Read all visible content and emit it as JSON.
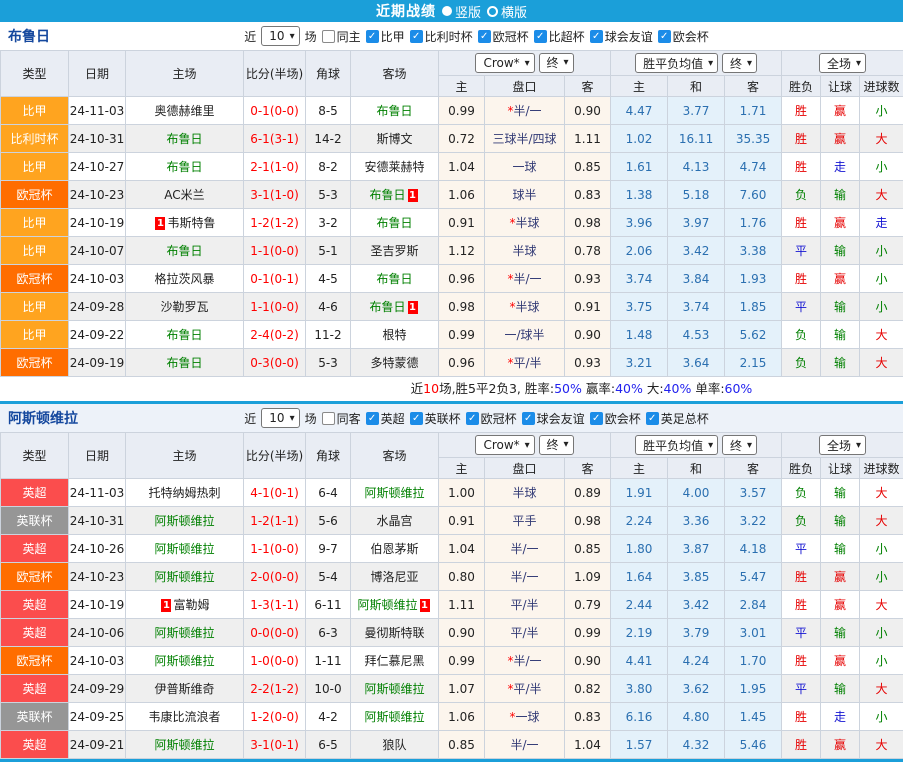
{
  "topbar": {
    "title": "近期战绩",
    "options": [
      {
        "label": "竖版",
        "selected": true
      },
      {
        "label": "横版",
        "selected": false
      }
    ]
  },
  "table_header": {
    "type": "类型",
    "date": "日期",
    "home": "主场",
    "score": "比分(半场)",
    "corner": "角球",
    "away": "客场",
    "dd_company": "Crow*",
    "dd_final": "终",
    "dd_avg": "胜平负均值",
    "dd_final2": "终",
    "dd_scope": "全场",
    "sub": {
      "home": "主",
      "handicap": "盘口",
      "away": "客",
      "avg_home": "主",
      "avg_draw": "和",
      "avg_away": "客",
      "result": "胜负",
      "let": "让球",
      "goals": "进球数"
    }
  },
  "colors": {
    "topbar_bg": "#1b9fd9",
    "checkbox_on": "#1b8ce8",
    "league": {
      "比甲": "#ffa41f",
      "比利时杯": "#ffa41f",
      "欧冠杯": "#ff6d00",
      "英超": "#fb4d4d",
      "英联杯": "#969696"
    },
    "result": {
      "胜": "#e60000",
      "负": "#008000",
      "平": "#1414d2",
      "赢": "#e60000",
      "输": "#008000",
      "走": "#1414d2",
      "大": "#e60000",
      "小": "#008000"
    },
    "team_highlight": "#008000",
    "score": "#ff0000",
    "handicap_text": "#333b76",
    "avg_text": "#2a6fb0"
  },
  "sections": [
    {
      "team": "布鲁日",
      "filters": {
        "near": "近",
        "count": "10",
        "games": "场",
        "same": "同主",
        "same_checked": false,
        "leagues": [
          "比甲",
          "比利时杯",
          "欧冠杯",
          "比超杯",
          "球会友谊",
          "欧会杯"
        ]
      },
      "rows": [
        {
          "type": "比甲",
          "date": "24-11-03",
          "home": "奥德赫维里",
          "home_card": "",
          "score": "0-1(0-0)",
          "corner": "8-5",
          "away": "布鲁日",
          "away_card": "",
          "odds_home": "0.99",
          "handicap": "*半/一",
          "odds_away": "0.90",
          "avg_home": "4.47",
          "avg_draw": "3.77",
          "avg_away": "1.71",
          "result": "胜",
          "let_result": "赢",
          "goals": "小"
        },
        {
          "type": "比利时杯",
          "date": "24-10-31",
          "home": "布鲁日",
          "home_card": "",
          "score": "6-1(3-1)",
          "corner": "14-2",
          "away": "斯博文",
          "away_card": "",
          "odds_home": "0.72",
          "handicap": "三球半/四球",
          "odds_away": "1.11",
          "avg_home": "1.02",
          "avg_draw": "16.11",
          "avg_away": "35.35",
          "result": "胜",
          "let_result": "赢",
          "goals": "大"
        },
        {
          "type": "比甲",
          "date": "24-10-27",
          "home": "布鲁日",
          "home_card": "",
          "score": "2-1(1-0)",
          "corner": "8-2",
          "away": "安德莱赫特",
          "away_card": "",
          "odds_home": "1.04",
          "handicap": "一球",
          "odds_away": "0.85",
          "avg_home": "1.61",
          "avg_draw": "4.13",
          "avg_away": "4.74",
          "result": "胜",
          "let_result": "走",
          "goals": "小"
        },
        {
          "type": "欧冠杯",
          "date": "24-10-23",
          "home": "AC米兰",
          "home_card": "",
          "score": "3-1(1-0)",
          "corner": "5-3",
          "away": "布鲁日",
          "away_card": "1",
          "odds_home": "1.06",
          "handicap": "球半",
          "odds_away": "0.83",
          "avg_home": "1.38",
          "avg_draw": "5.18",
          "avg_away": "7.60",
          "result": "负",
          "let_result": "输",
          "goals": "大"
        },
        {
          "type": "比甲",
          "date": "24-10-19",
          "home": "韦斯特鲁",
          "home_card": "1",
          "score": "1-2(1-2)",
          "corner": "3-2",
          "away": "布鲁日",
          "away_card": "",
          "odds_home": "0.91",
          "handicap": "*半球",
          "odds_away": "0.98",
          "avg_home": "3.96",
          "avg_draw": "3.97",
          "avg_away": "1.76",
          "result": "胜",
          "let_result": "赢",
          "goals": "走"
        },
        {
          "type": "比甲",
          "date": "24-10-07",
          "home": "布鲁日",
          "home_card": "",
          "score": "1-1(0-0)",
          "corner": "5-1",
          "away": "圣吉罗斯",
          "away_card": "",
          "odds_home": "1.12",
          "handicap": "半球",
          "odds_away": "0.78",
          "avg_home": "2.06",
          "avg_draw": "3.42",
          "avg_away": "3.38",
          "result": "平",
          "let_result": "输",
          "goals": "小"
        },
        {
          "type": "欧冠杯",
          "date": "24-10-03",
          "home": "格拉茨风暴",
          "home_card": "",
          "score": "0-1(0-1)",
          "corner": "4-5",
          "away": "布鲁日",
          "away_card": "",
          "odds_home": "0.96",
          "handicap": "*半/一",
          "odds_away": "0.93",
          "avg_home": "3.74",
          "avg_draw": "3.84",
          "avg_away": "1.93",
          "result": "胜",
          "let_result": "赢",
          "goals": "小"
        },
        {
          "type": "比甲",
          "date": "24-09-28",
          "home": "沙勒罗瓦",
          "home_card": "",
          "score": "1-1(0-0)",
          "corner": "4-6",
          "away": "布鲁日",
          "away_card": "1",
          "odds_home": "0.98",
          "handicap": "*半球",
          "odds_away": "0.91",
          "avg_home": "3.75",
          "avg_draw": "3.74",
          "avg_away": "1.85",
          "result": "平",
          "let_result": "输",
          "goals": "小"
        },
        {
          "type": "比甲",
          "date": "24-09-22",
          "home": "布鲁日",
          "home_card": "",
          "score": "2-4(0-2)",
          "corner": "11-2",
          "away": "根特",
          "away_card": "",
          "odds_home": "0.99",
          "handicap": "一/球半",
          "odds_away": "0.90",
          "avg_home": "1.48",
          "avg_draw": "4.53",
          "avg_away": "5.62",
          "result": "负",
          "let_result": "输",
          "goals": "大"
        },
        {
          "type": "欧冠杯",
          "date": "24-09-19",
          "home": "布鲁日",
          "home_card": "",
          "score": "0-3(0-0)",
          "corner": "5-3",
          "away": "多特蒙德",
          "away_card": "",
          "odds_home": "0.96",
          "handicap": "*平/半",
          "odds_away": "0.93",
          "avg_home": "3.21",
          "avg_draw": "3.64",
          "avg_away": "2.15",
          "result": "负",
          "let_result": "输",
          "goals": "大"
        }
      ],
      "summary": [
        {
          "text": "近",
          "color": "#222222"
        },
        {
          "text": "10",
          "color": "#ff0000"
        },
        {
          "text": "场,胜5平2负3, 胜率:",
          "color": "#222222"
        },
        {
          "text": "50%",
          "color": "#2222ee"
        },
        {
          "text": " 赢率:",
          "color": "#222222"
        },
        {
          "text": "40%",
          "color": "#2222ee"
        },
        {
          "text": " 大:",
          "color": "#222222"
        },
        {
          "text": "40%",
          "color": "#2222ee"
        },
        {
          "text": " 单率:",
          "color": "#222222"
        },
        {
          "text": "60%",
          "color": "#2222ee"
        }
      ]
    },
    {
      "team": "阿斯顿维拉",
      "filters": {
        "near": "近",
        "count": "10",
        "games": "场",
        "same": "同客",
        "same_checked": false,
        "leagues": [
          "英超",
          "英联杯",
          "欧冠杯",
          "球会友谊",
          "欧会杯",
          "英足总杯"
        ]
      },
      "rows": [
        {
          "type": "英超",
          "date": "24-11-03",
          "home": "托特纳姆热刺",
          "home_card": "",
          "score": "4-1(0-1)",
          "corner": "6-4",
          "away": "阿斯顿维拉",
          "away_card": "",
          "odds_home": "1.00",
          "handicap": "半球",
          "odds_away": "0.89",
          "avg_home": "1.91",
          "avg_draw": "4.00",
          "avg_away": "3.57",
          "result": "负",
          "let_result": "输",
          "goals": "大"
        },
        {
          "type": "英联杯",
          "date": "24-10-31",
          "home": "阿斯顿维拉",
          "home_card": "",
          "score": "1-2(1-1)",
          "corner": "5-6",
          "away": "水晶宫",
          "away_card": "",
          "odds_home": "0.91",
          "handicap": "平手",
          "odds_away": "0.98",
          "avg_home": "2.24",
          "avg_draw": "3.36",
          "avg_away": "3.22",
          "result": "负",
          "let_result": "输",
          "goals": "大"
        },
        {
          "type": "英超",
          "date": "24-10-26",
          "home": "阿斯顿维拉",
          "home_card": "",
          "score": "1-1(0-0)",
          "corner": "9-7",
          "away": "伯恩茅斯",
          "away_card": "",
          "odds_home": "1.04",
          "handicap": "半/一",
          "odds_away": "0.85",
          "avg_home": "1.80",
          "avg_draw": "3.87",
          "avg_away": "4.18",
          "result": "平",
          "let_result": "输",
          "goals": "小"
        },
        {
          "type": "欧冠杯",
          "date": "24-10-23",
          "home": "阿斯顿维拉",
          "home_card": "",
          "score": "2-0(0-0)",
          "corner": "5-4",
          "away": "博洛尼亚",
          "away_card": "",
          "odds_home": "0.80",
          "handicap": "半/一",
          "odds_away": "1.09",
          "avg_home": "1.64",
          "avg_draw": "3.85",
          "avg_away": "5.47",
          "result": "胜",
          "let_result": "赢",
          "goals": "小"
        },
        {
          "type": "英超",
          "date": "24-10-19",
          "home": "富勒姆",
          "home_card": "1",
          "score": "1-3(1-1)",
          "corner": "6-11",
          "away": "阿斯顿维拉",
          "away_card": "1",
          "odds_home": "1.11",
          "handicap": "平/半",
          "odds_away": "0.79",
          "avg_home": "2.44",
          "avg_draw": "3.42",
          "avg_away": "2.84",
          "result": "胜",
          "let_result": "赢",
          "goals": "大"
        },
        {
          "type": "英超",
          "date": "24-10-06",
          "home": "阿斯顿维拉",
          "home_card": "",
          "score": "0-0(0-0)",
          "corner": "6-3",
          "away": "曼彻斯特联",
          "away_card": "",
          "odds_home": "0.90",
          "handicap": "平/半",
          "odds_away": "0.99",
          "avg_home": "2.19",
          "avg_draw": "3.79",
          "avg_away": "3.01",
          "result": "平",
          "let_result": "输",
          "goals": "小"
        },
        {
          "type": "欧冠杯",
          "date": "24-10-03",
          "home": "阿斯顿维拉",
          "home_card": "",
          "score": "1-0(0-0)",
          "corner": "1-11",
          "away": "拜仁慕尼黑",
          "away_card": "",
          "odds_home": "0.99",
          "handicap": "*半/一",
          "odds_away": "0.90",
          "avg_home": "4.41",
          "avg_draw": "4.24",
          "avg_away": "1.70",
          "result": "胜",
          "let_result": "赢",
          "goals": "小"
        },
        {
          "type": "英超",
          "date": "24-09-29",
          "home": "伊普斯维奇",
          "home_card": "",
          "score": "2-2(1-2)",
          "corner": "10-0",
          "away": "阿斯顿维拉",
          "away_card": "",
          "odds_home": "1.07",
          "handicap": "*平/半",
          "odds_away": "0.82",
          "avg_home": "3.80",
          "avg_draw": "3.62",
          "avg_away": "1.95",
          "result": "平",
          "let_result": "输",
          "goals": "大"
        },
        {
          "type": "英联杯",
          "date": "24-09-25",
          "home": "韦康比流浪者",
          "home_card": "",
          "score": "1-2(0-0)",
          "corner": "4-2",
          "away": "阿斯顿维拉",
          "away_card": "",
          "odds_home": "1.06",
          "handicap": "*一球",
          "odds_away": "0.83",
          "avg_home": "6.16",
          "avg_draw": "4.80",
          "avg_away": "1.45",
          "result": "胜",
          "let_result": "走",
          "goals": "小"
        },
        {
          "type": "英超",
          "date": "24-09-21",
          "home": "阿斯顿维拉",
          "home_card": "",
          "score": "3-1(0-1)",
          "corner": "6-5",
          "away": "狼队",
          "away_card": "",
          "odds_home": "0.85",
          "handicap": "半/一",
          "odds_away": "1.04",
          "avg_home": "1.57",
          "avg_draw": "4.32",
          "avg_away": "5.46",
          "result": "胜",
          "let_result": "赢",
          "goals": "大"
        }
      ],
      "summary": null
    }
  ]
}
